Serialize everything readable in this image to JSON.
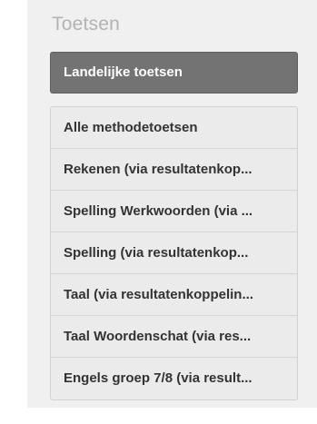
{
  "section": {
    "title": "Toetsen"
  },
  "primary_button": {
    "label": "Landelijke toetsen"
  },
  "method_list": {
    "items": [
      "Alle methodetoetsen",
      "Rekenen (via resultatenkop...",
      "Spelling Werkwoorden (via ...",
      "Spelling (via resultatenkop...",
      "Taal (via resultatenkoppelin...",
      "Taal Woordenschat (via res...",
      "Engels groep 7/8 (via result..."
    ]
  },
  "colors": {
    "panel_background": "#f0f0f0",
    "primary_button_background": "#737373",
    "list_item_background": "#ebebeb",
    "title_text": "#b3b3b3",
    "item_text": "#333333"
  }
}
